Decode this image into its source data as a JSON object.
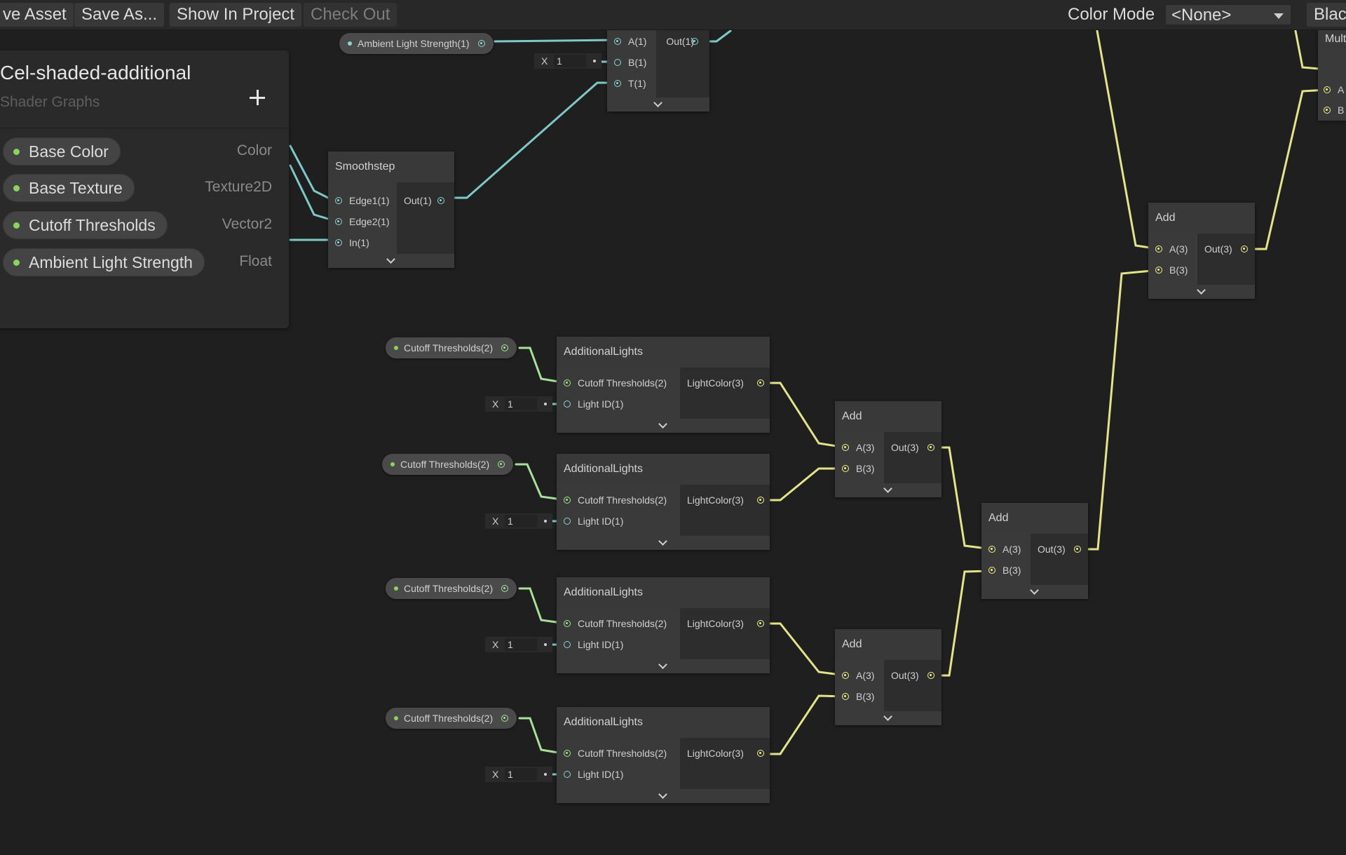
{
  "toolbar": {
    "save_asset": "ve Asset",
    "save_as": "Save As...",
    "show_in_project": "Show In Project",
    "check_out": "Check Out",
    "color_mode_label": "Color Mode",
    "color_mode_value": "<None>",
    "blackboard_toggle": "Blac"
  },
  "blackboard": {
    "title": "Cel-shaded-additional",
    "subtitle": "Shader Graphs",
    "properties": [
      {
        "name": "Base Color",
        "type": "Color"
      },
      {
        "name": "Base Texture",
        "type": "Texture2D"
      },
      {
        "name": "Cutoff Thresholds",
        "type": "Vector2"
      },
      {
        "name": "Ambient Light Strength",
        "type": "Float"
      }
    ]
  },
  "props": {
    "ambient": "Ambient Light Strength(1)",
    "cutoff": "Cutoff Thresholds(2)"
  },
  "lerp": {
    "a": "A(1)",
    "b": "B(1)",
    "t": "T(1)",
    "out": "Out(1)",
    "b_axis": "X",
    "b_value": "1"
  },
  "smoothstep": {
    "title": "Smoothstep",
    "edge1": "Edge1(1)",
    "edge2": "Edge2(1)",
    "in": "In(1)",
    "out": "Out(1)"
  },
  "additional_lights": {
    "title": "AdditionalLights",
    "in_cutoff": "Cutoff Thresholds(2)",
    "in_light_id": "Light ID(1)",
    "out_color": "LightColor(3)",
    "axis": "X",
    "value": "1"
  },
  "add": {
    "title": "Add",
    "a": "A(3)",
    "b": "B(3)",
    "out": "Out(3)"
  },
  "multiply": {
    "title": "Mult",
    "a": "A",
    "b": "B"
  },
  "colors": {
    "wire_float": "#7ec8c8",
    "wire_vector3": "#e3e38a",
    "wire_vector2": "#a6e09a",
    "property_dot": "#8bd35c"
  }
}
